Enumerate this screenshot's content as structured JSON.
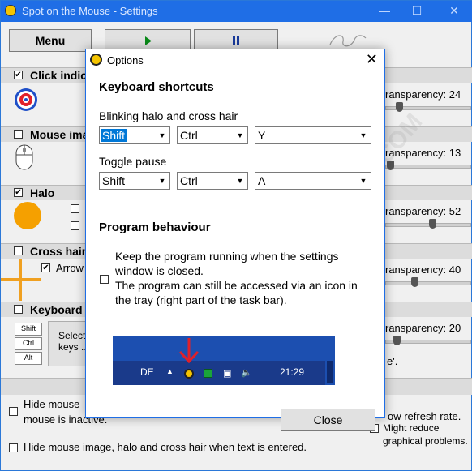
{
  "main": {
    "title": "Spot on the Mouse - Settings",
    "controls": {
      "minimize": "—",
      "maximize": "☐",
      "close": "✕"
    },
    "menu_label": "Menu",
    "sections": {
      "click_indicator": "Click indic",
      "mouse_image": "Mouse ima",
      "halo": "Halo",
      "cross_hair": "Cross hair",
      "keyboard": "Keyboard"
    },
    "arrow_label": "Arrow",
    "transparency": [
      "ransparency: 24",
      "ransparency: 13",
      "ransparency: 52",
      "ransparency: 40",
      "ransparency: 20"
    ],
    "keys": [
      "Shift",
      "Ctrl",
      "Alt"
    ],
    "select_keys": "Select\nkeys ..",
    "quote_text": "e'.",
    "hide_inactive_1": "Hide mouse",
    "hide_inactive_2": "mouse is inactive.",
    "low_refresh": "ow refresh rate.",
    "might_reduce_1": "Might reduce",
    "might_reduce_2": "graphical problems.",
    "hide_text_entered": "Hide mouse image, halo and cross hair when text is entered.",
    "colors": {
      "accent": "#1f6ee6",
      "halo": "#f5a000",
      "cross": "#f0a020",
      "red": "#e0202a"
    }
  },
  "dialog": {
    "title": "Options",
    "close_icon": "close-icon",
    "keyboard_shortcuts": "Keyboard shortcuts",
    "blinking_label": "Blinking halo and cross hair",
    "blinking": {
      "mod1": "Shift",
      "mod2": "Ctrl",
      "key": "Y"
    },
    "toggle_label": "Toggle pause",
    "toggle": {
      "mod1": "Shift",
      "mod2": "Ctrl",
      "key": "A"
    },
    "program_behaviour": "Program behaviour",
    "keep_running": "Keep the program running when the settings window is closed.",
    "keep_running_2": "The program can still be accessed via an icon in the tray (right part of the task bar).",
    "tray": {
      "lang": "DE",
      "time": "21:29"
    },
    "close_button": "Close"
  }
}
